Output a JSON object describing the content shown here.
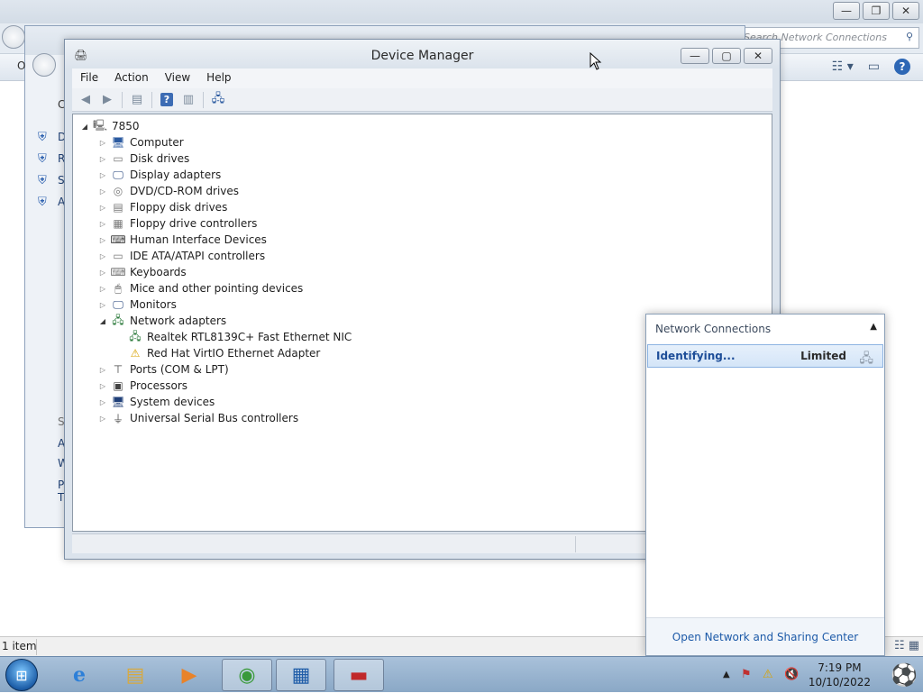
{
  "background_explorer": {
    "search_placeholder": "Search Network Connections",
    "status_text": "1 item"
  },
  "control_panel": {
    "left_letters": [
      "D",
      "R",
      "S",
      "A"
    ],
    "left_letters_lower": [
      "S",
      "A",
      "W",
      "P",
      "T"
    ],
    "o_letter": "O",
    "c_letter": "C"
  },
  "device_manager": {
    "title": "Device Manager",
    "menu": [
      "File",
      "Action",
      "View",
      "Help"
    ],
    "root": "7850",
    "categories": [
      {
        "label": "Computer",
        "icon": "computer-icon"
      },
      {
        "label": "Disk drives",
        "icon": "disk-drive-icon"
      },
      {
        "label": "Display adapters",
        "icon": "display-adapter-icon"
      },
      {
        "label": "DVD/CD-ROM drives",
        "icon": "dvd-drive-icon"
      },
      {
        "label": "Floppy disk drives",
        "icon": "floppy-disk-icon"
      },
      {
        "label": "Floppy drive controllers",
        "icon": "floppy-controller-icon"
      },
      {
        "label": "Human Interface Devices",
        "icon": "hid-icon"
      },
      {
        "label": "IDE ATA/ATAPI controllers",
        "icon": "ide-controller-icon"
      },
      {
        "label": "Keyboards",
        "icon": "keyboard-icon"
      },
      {
        "label": "Mice and other pointing devices",
        "icon": "mouse-icon"
      },
      {
        "label": "Monitors",
        "icon": "monitor-icon"
      },
      {
        "label": "Network adapters",
        "icon": "network-adapter-icon"
      }
    ],
    "network_children": [
      {
        "label": "Realtek RTL8139C+ Fast Ethernet NIC",
        "icon": "network-card-icon"
      },
      {
        "label": "Red Hat VirtIO Ethernet Adapter",
        "icon": "network-card-warning-icon"
      }
    ],
    "categories_after": [
      {
        "label": "Ports (COM & LPT)",
        "icon": "port-icon"
      },
      {
        "label": "Processors",
        "icon": "processor-icon"
      },
      {
        "label": "System devices",
        "icon": "system-device-icon"
      },
      {
        "label": "Universal Serial Bus controllers",
        "icon": "usb-icon"
      }
    ]
  },
  "network_flyout": {
    "header": "Network Connections",
    "connection_name": "Identifying...",
    "connection_status": "Limited",
    "footer_link": "Open Network and Sharing Center"
  },
  "taskbar": {
    "time": "7:19 PM",
    "date": "10/10/2022"
  }
}
